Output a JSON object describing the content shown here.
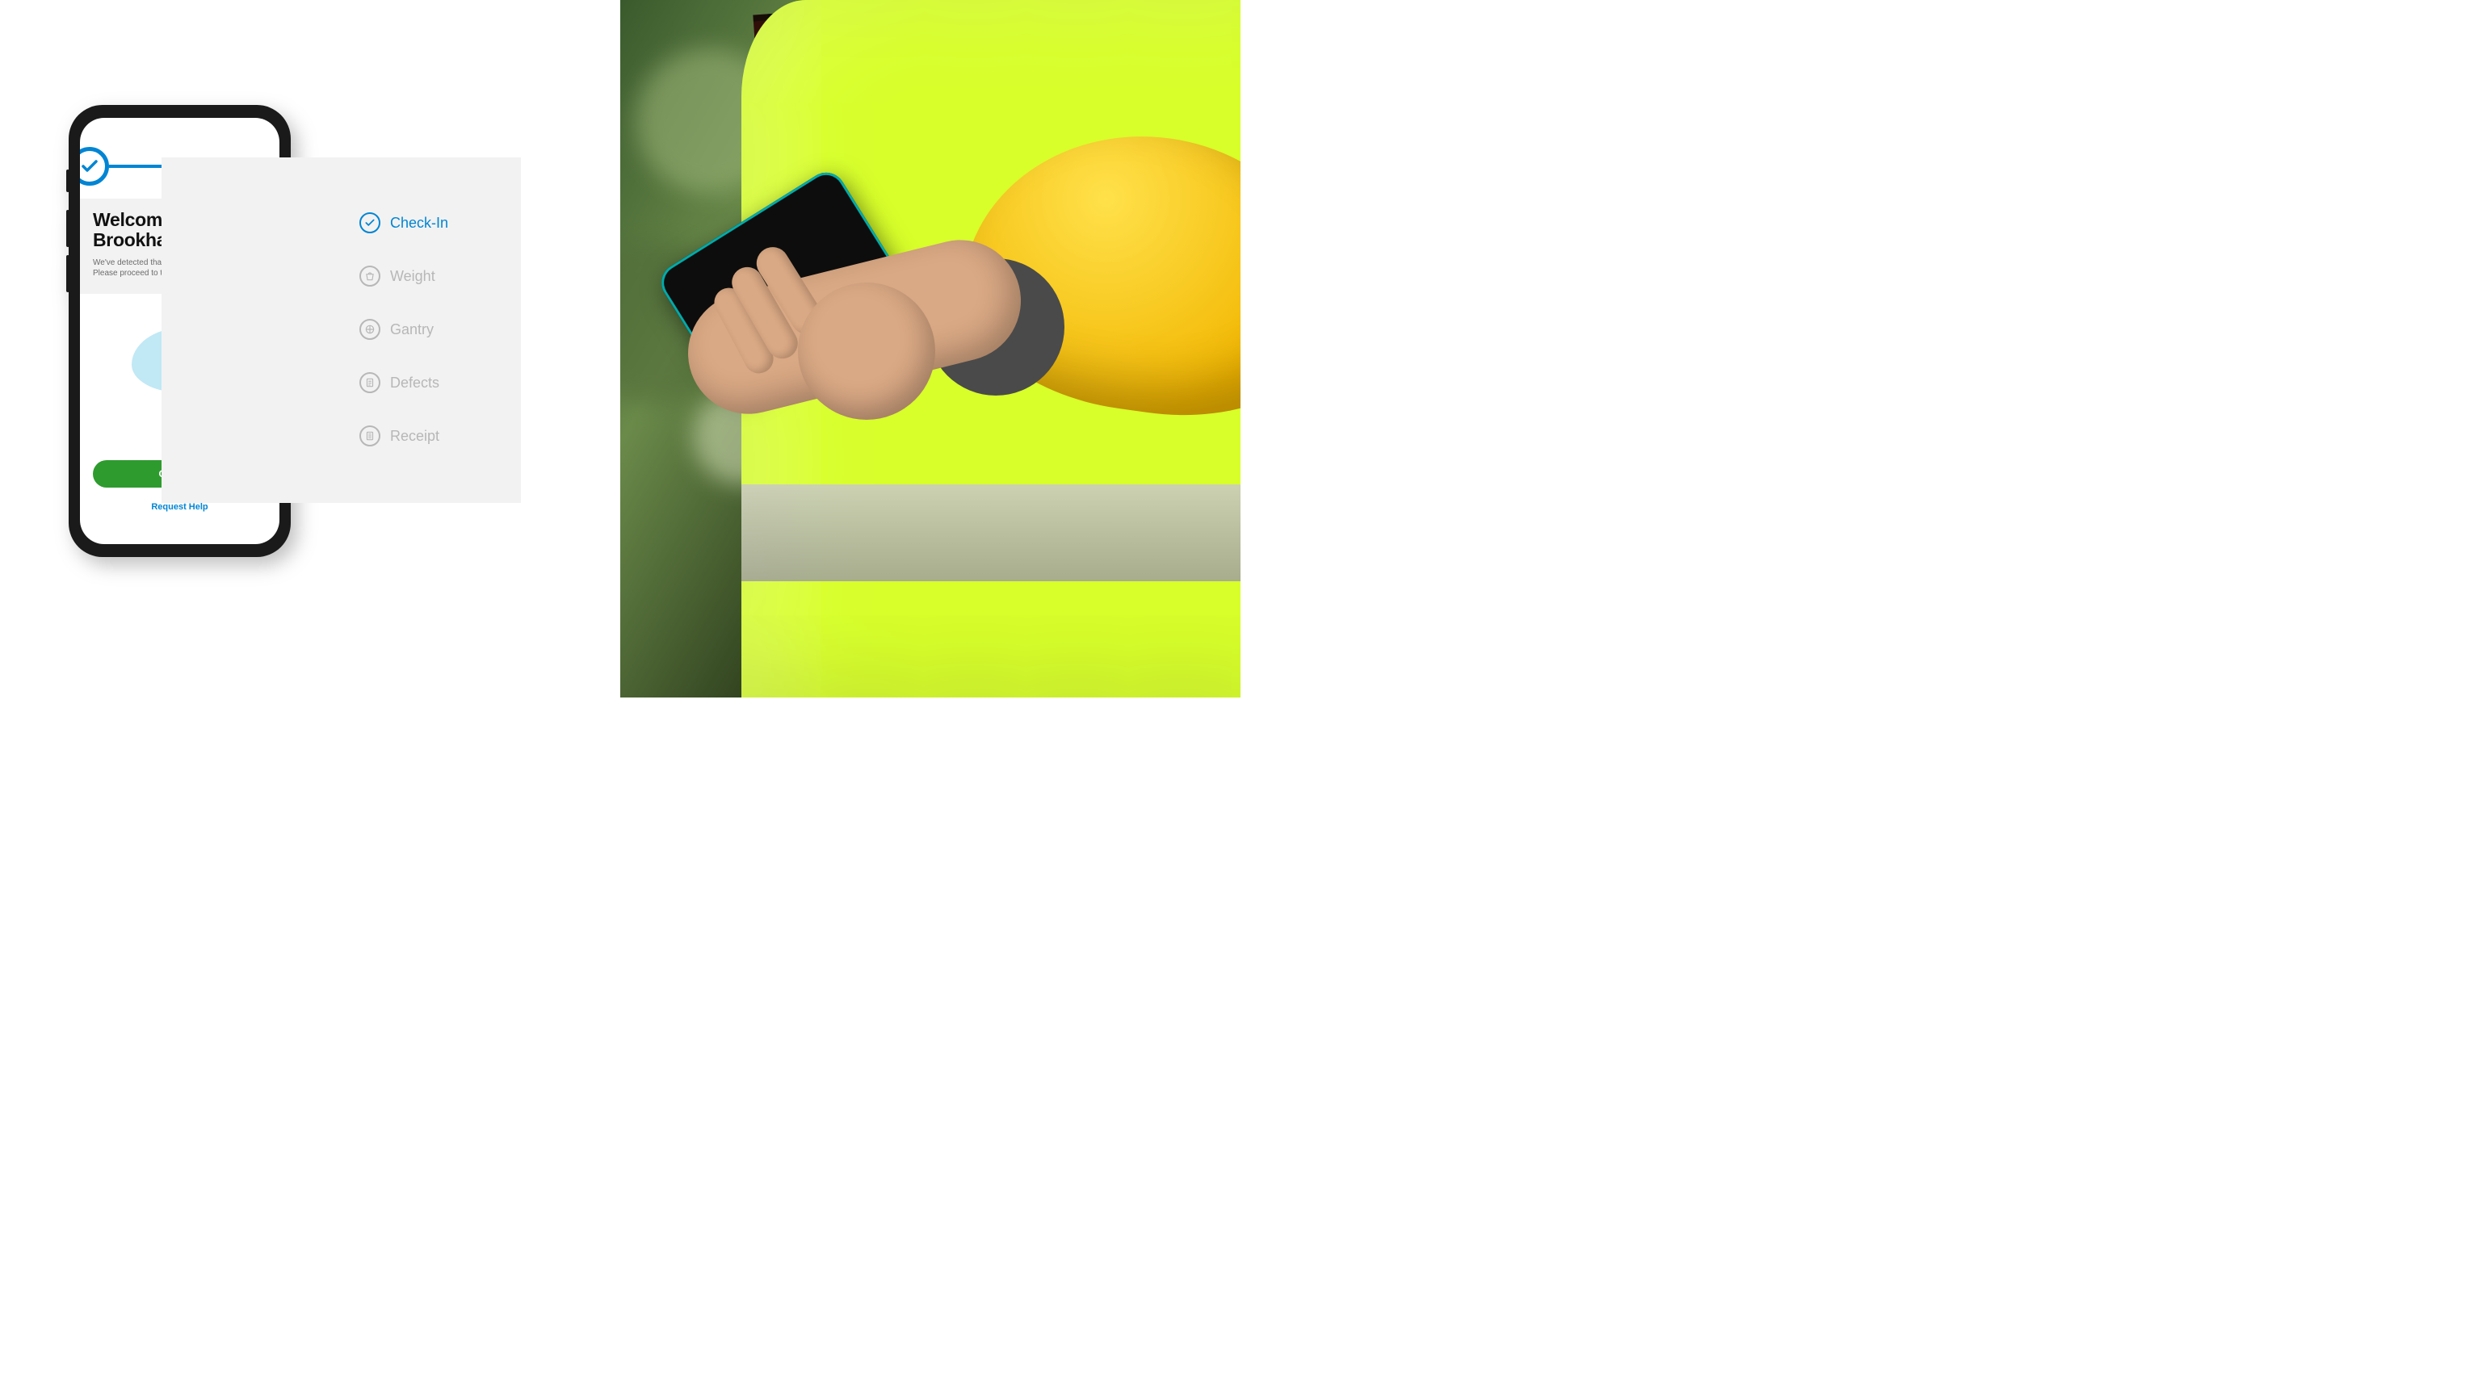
{
  "app": {
    "welcome_title_line1": "Welcome to",
    "welcome_title_line2": "Brookhaven, MS",
    "welcome_subtext": "We've detected that you've arrived.\nPlease proceed to the first kiosk.",
    "continue_label": "Continue",
    "help_link_label": "Request Help"
  },
  "steps": [
    {
      "label": "Check-In",
      "active": true
    },
    {
      "label": "Weight",
      "active": false
    },
    {
      "label": "Gantry",
      "active": false
    },
    {
      "label": "Defects",
      "active": false
    },
    {
      "label": "Receipt",
      "active": false
    }
  ],
  "colors": {
    "primary_blue": "#0085d4",
    "action_green": "#2e9b2e",
    "inactive_grey": "#b7b7b7"
  }
}
